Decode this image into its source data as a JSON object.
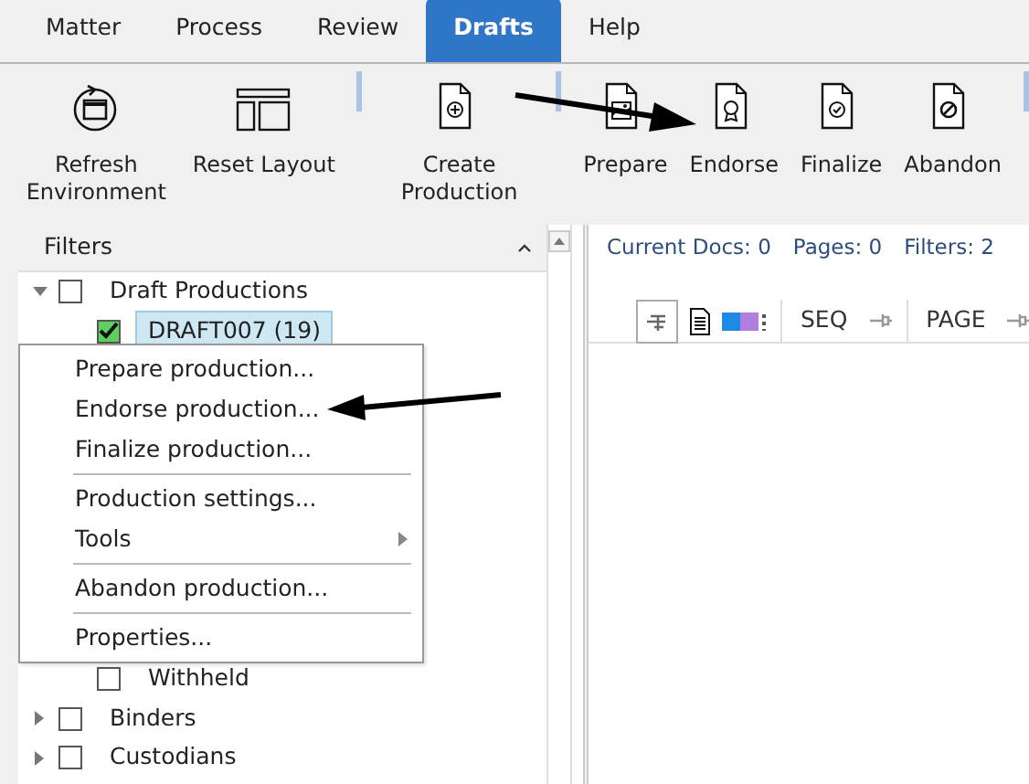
{
  "tabs": [
    {
      "label": "Matter",
      "selected": false
    },
    {
      "label": "Process",
      "selected": false
    },
    {
      "label": "Review",
      "selected": false
    },
    {
      "label": "Drafts",
      "selected": true
    },
    {
      "label": "Help",
      "selected": false
    }
  ],
  "toolbar": {
    "groups": [
      [
        {
          "label": "Refresh Environment",
          "kind": "refresh"
        },
        {
          "label": "Reset Layout",
          "kind": "layout"
        }
      ],
      [
        {
          "label": "Create Production",
          "kind": "create"
        }
      ],
      [
        {
          "label": "Prepare",
          "kind": "prepare"
        },
        {
          "label": "Endorse",
          "kind": "endorse"
        },
        {
          "label": "Finalize",
          "kind": "finalize"
        },
        {
          "label": "Abandon",
          "kind": "abandon"
        }
      ]
    ]
  },
  "filters": {
    "title": "Filters",
    "items": [
      {
        "label": "Draft Productions",
        "expanded": true,
        "checked": false,
        "selected": false,
        "children": [
          {
            "label": "DRAFT007 (19)",
            "checked": true,
            "selected": true
          },
          {
            "label": "Withheld",
            "checked": false,
            "selected": false
          }
        ]
      },
      {
        "label": "Binders",
        "expanded": false,
        "checked": false,
        "selected": false
      },
      {
        "label": "Custodians",
        "expanded": false,
        "checked": false,
        "selected": false
      }
    ]
  },
  "context_menu": [
    {
      "kind": "item",
      "label": "Prepare production..."
    },
    {
      "kind": "item",
      "label": "Endorse production..."
    },
    {
      "kind": "item",
      "label": "Finalize production..."
    },
    {
      "kind": "separator"
    },
    {
      "kind": "item",
      "label": "Production settings..."
    },
    {
      "kind": "submenu",
      "label": "Tools"
    },
    {
      "kind": "separator"
    },
    {
      "kind": "item",
      "label": "Abandon production..."
    },
    {
      "kind": "separator"
    },
    {
      "kind": "item",
      "label": "Properties..."
    }
  ],
  "status": [
    "Current Docs: 0",
    "Pages: 0",
    "Filters: 2"
  ],
  "grid": {
    "columns": [
      "SEQ",
      "PAGE"
    ]
  }
}
